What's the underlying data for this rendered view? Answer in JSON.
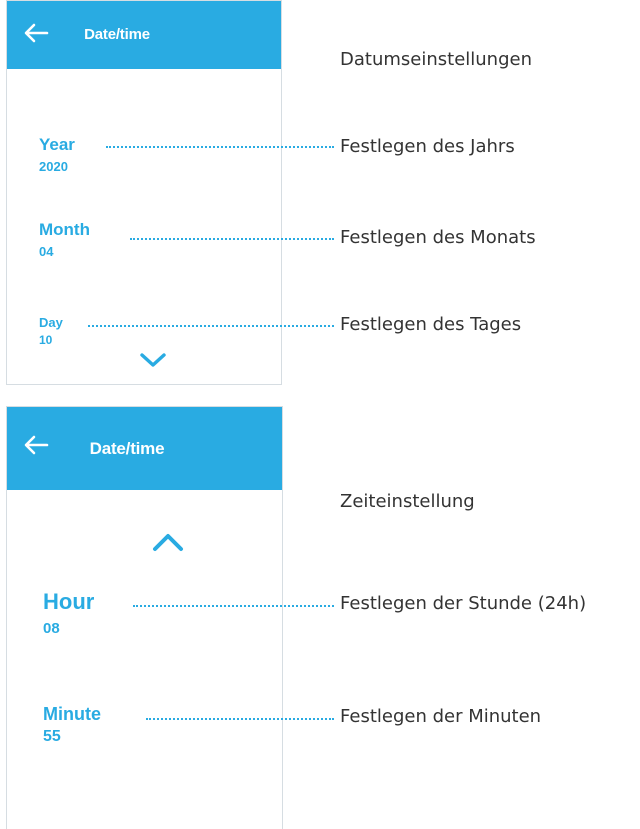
{
  "date_screen": {
    "title": "Date/time",
    "fields": [
      {
        "label": "Year",
        "value": "2020"
      },
      {
        "label": "Month",
        "value": "04"
      },
      {
        "label": "Day",
        "value": "10"
      }
    ]
  },
  "time_screen": {
    "title": "Date/time",
    "fields": [
      {
        "label": "Hour",
        "value": "08"
      },
      {
        "label": "Minute",
        "value": "55"
      }
    ]
  },
  "annotations": {
    "date_section": "Datumseinstellungen",
    "time_section": "Zeiteinstellung",
    "year": "Festlegen des Jahrs",
    "month": "Festlegen des Monats",
    "day": "Festlegen des Tages",
    "hour": "Festlegen der Stunde (24h)",
    "minute": "Festlegen der Minuten"
  },
  "icons": {
    "back": "arrow-left-icon",
    "scroll_down": "chevron-down-icon",
    "scroll_up": "chevron-up-icon"
  },
  "colors": {
    "accent": "#29abe2",
    "annotation_text": "#333333",
    "background": "#ffffff"
  }
}
